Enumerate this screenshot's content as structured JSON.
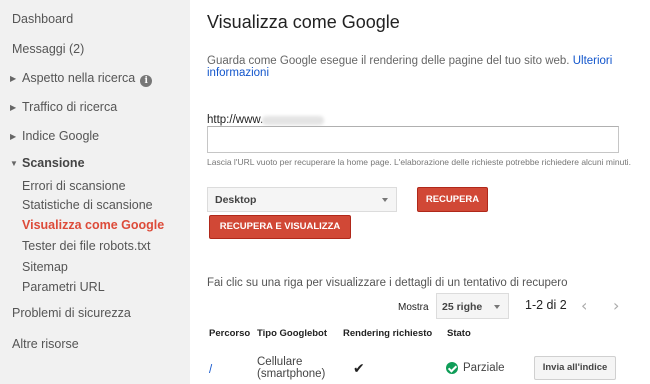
{
  "sidebar": {
    "dashboard": "Dashboard",
    "messaggi": "Messaggi (2)",
    "aspetto": "Aspetto nella ricerca",
    "traffico": "Traffico di ricerca",
    "indice": "Indice Google",
    "scansione": "Scansione",
    "sub": [
      "Errori di scansione",
      "Statistiche di scansione",
      "Visualizza come Google",
      "Tester dei file robots.txt",
      "Sitemap",
      "Parametri URL"
    ],
    "problemi": "Problemi di sicurezza",
    "altre": "Altre risorse"
  },
  "main": {
    "title": "Visualizza come Google",
    "intro": "Guarda come Google esegue il rendering delle pagine del tuo sito web.",
    "intro_link": "Ulteriori informazioni",
    "url_prefix": "http://www.",
    "url_value": "",
    "hint": "Lascia l'URL vuoto per recuperare la home page. L'elaborazione delle richieste potrebbe richiedere alcuni minuti.",
    "device": "Desktop",
    "btn_recupera": "RECUPERA",
    "btn_recupera_vis": "RECUPERA E VISUALIZZA",
    "table_caption": "Fai clic su una riga per visualizzare i dettagli di un tentativo di recupero",
    "show_label": "Mostra",
    "rows_per_page": "25 righe",
    "range": "1-2 di 2",
    "headers": [
      "Percorso",
      "Tipo Googlebot",
      "Rendering richiesto",
      "Stato"
    ],
    "row": {
      "path": "/",
      "bot": "Cellulare (smartphone)",
      "status": "Parziale",
      "action": "Invia all'indice"
    }
  },
  "colors": {
    "accent": "#d14836",
    "link": "#1155cc",
    "active": "#dd4b39",
    "ok": "#0f9d58"
  }
}
